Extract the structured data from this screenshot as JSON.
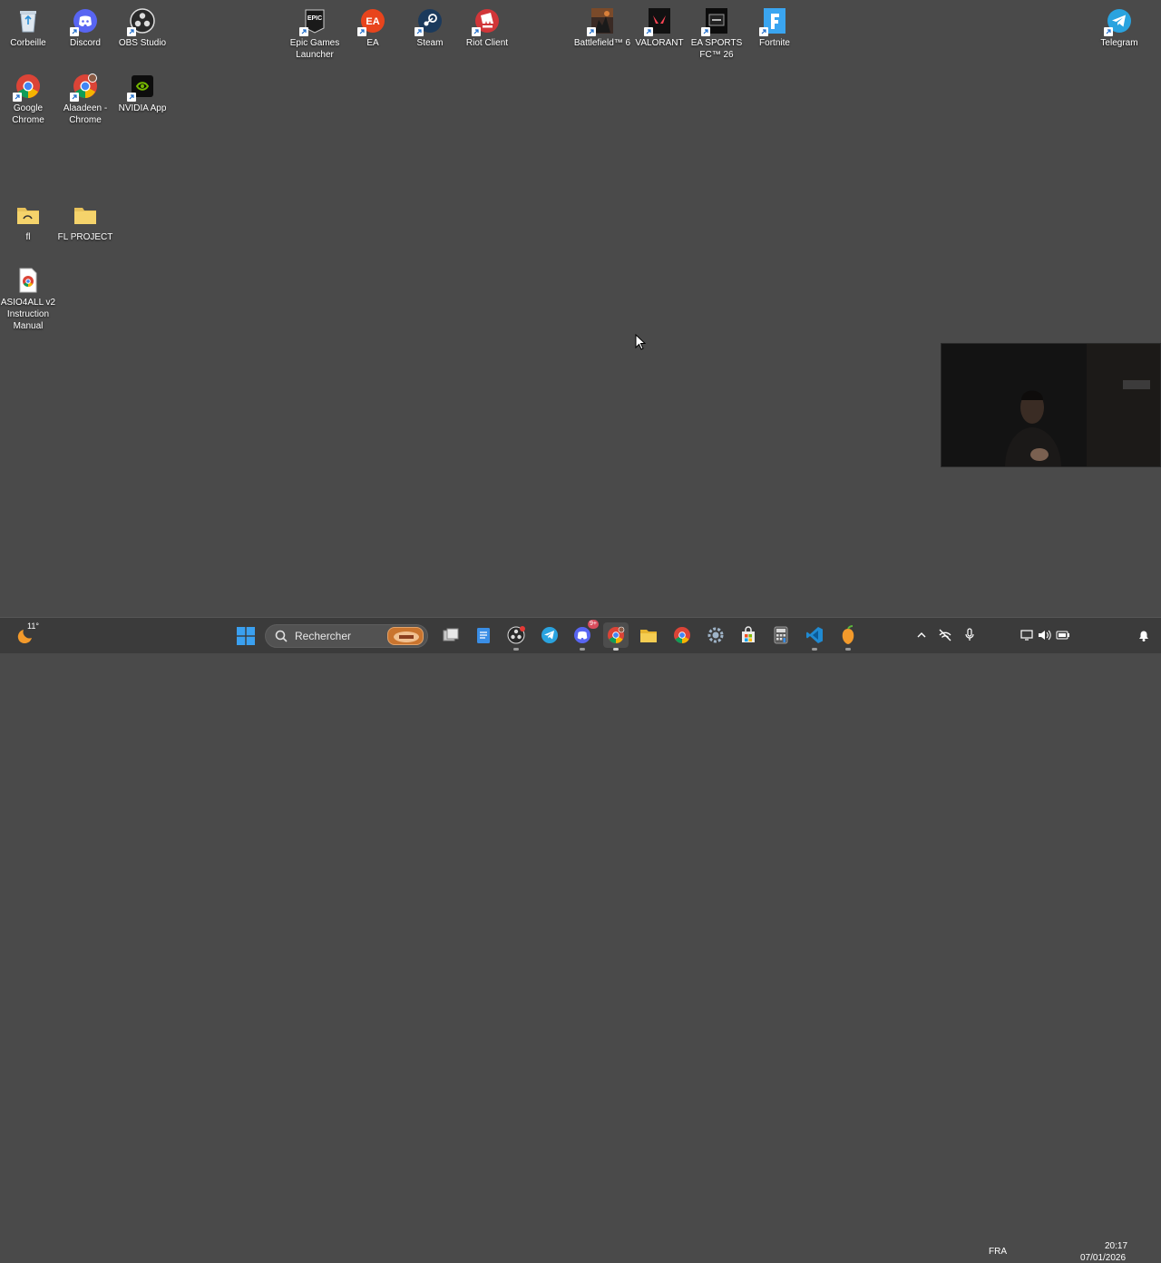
{
  "desktop_icons": {
    "corbeille": "Corbeille",
    "discord": "Discord",
    "obs": "OBS Studio",
    "epic": "Epic Games Launcher",
    "ea": "EA",
    "steam": "Steam",
    "riot": "Riot Client",
    "battlefield": "Battlefield™ 6",
    "valorant": "VALORANT",
    "eafc": "EA SPORTS FC™ 26",
    "fortnite": "Fortnite",
    "telegram": "Telegram",
    "chrome": "Google Chrome",
    "alaadeen_chrome": "Alaadeen - Chrome",
    "nvidia": "NVIDIA App",
    "fl": "fl",
    "fl_project": "FL PROJECT",
    "asio": "ASIO4ALL v2 Instruction Manual"
  },
  "taskbar": {
    "weather_temp": "11°",
    "search_label": "Rechercher",
    "language": "FRA",
    "time": "20:17",
    "date": "07/01/2026",
    "discord_badge": "9+"
  },
  "colors": {
    "desktop_bg": "#4a4a4a",
    "taskbar_bg": "#3b3b3b",
    "windows_blue": "#1e90ff"
  }
}
